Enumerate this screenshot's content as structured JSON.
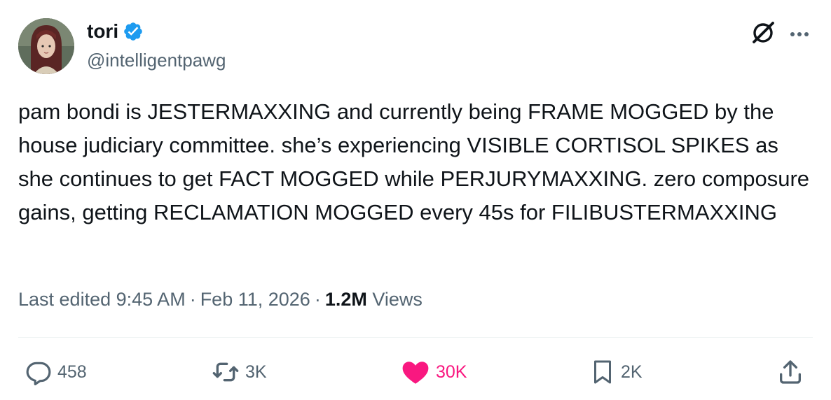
{
  "author": {
    "display_name": "tori",
    "handle": "@intelligentpawg",
    "verified": true,
    "verified_color": "#1d9bf0"
  },
  "tweet": {
    "text": "pam bondi is JESTERMAXXING and currently being FRAME MOGGED by the house judiciary committee. she’s experiencing VISIBLE CORTISOL SPIKES as she continues to get FACT MOGGED while PERJURYMAXXING. zero composure gains, getting RECLAMATION MOGGED every 45s for FILIBUSTERMAXXING",
    "edited_label": "Last edited",
    "time": "9:45 AM",
    "date": "Feb 11, 2026",
    "views_count": "1.2M",
    "views_label": "Views"
  },
  "top_actions": {
    "grok_icon": "grok-icon",
    "more_icon": "more-options-icon"
  },
  "actions": {
    "replies": "458",
    "reposts": "3K",
    "likes": "30K",
    "bookmarks": "2K",
    "liked": true,
    "like_color": "#f91880",
    "icon_color": "#536471"
  }
}
